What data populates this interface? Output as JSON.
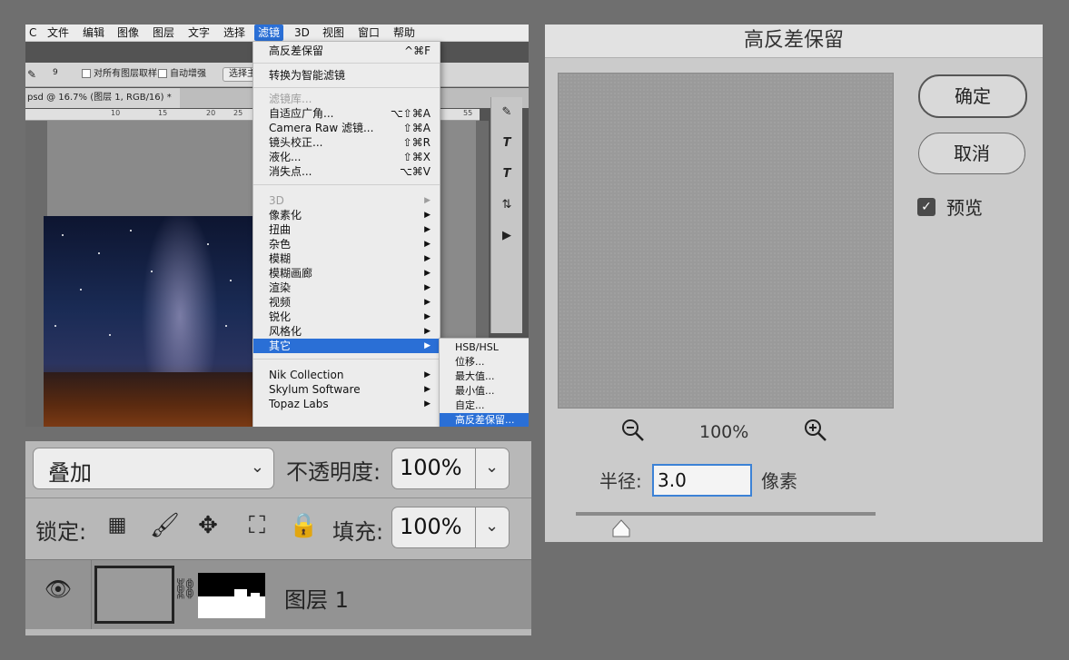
{
  "menubar": {
    "items": [
      "C",
      "文件",
      "编辑",
      "图像",
      "图层",
      "文字",
      "选择",
      "滤镜",
      "3D",
      "视图",
      "窗口",
      "帮助"
    ],
    "active": "滤镜"
  },
  "options_bar": {
    "brush_size": "9",
    "sample_all_layers": "对所有图层取样",
    "auto_enhance": "自动增强",
    "select_subject": "选择主"
  },
  "document_tab": "psd @ 16.7% (图层 1, RGB/16) *",
  "ruler_ticks": [
    "10",
    "15",
    "20",
    "25",
    "55"
  ],
  "filter_menu": {
    "items": [
      {
        "label": "高反差保留",
        "shortcut": "^⌘F"
      },
      {
        "label": "转换为智能滤镜"
      },
      {
        "label": "滤镜库...",
        "disabled": true
      },
      {
        "label": "自适应广角...",
        "shortcut": "⌥⇧⌘A"
      },
      {
        "label": "Camera Raw 滤镜...",
        "shortcut": "⇧⌘A"
      },
      {
        "label": "镜头校正...",
        "shortcut": "⇧⌘R"
      },
      {
        "label": "液化...",
        "shortcut": "⇧⌘X"
      },
      {
        "label": "消失点...",
        "shortcut": "⌥⌘V"
      },
      {
        "label": "3D",
        "disabled": true,
        "submenu": true
      },
      {
        "label": "像素化",
        "submenu": true
      },
      {
        "label": "扭曲",
        "submenu": true
      },
      {
        "label": "杂色",
        "submenu": true
      },
      {
        "label": "模糊",
        "submenu": true
      },
      {
        "label": "模糊画廊",
        "submenu": true
      },
      {
        "label": "渲染",
        "submenu": true
      },
      {
        "label": "视频",
        "submenu": true
      },
      {
        "label": "锐化",
        "submenu": true
      },
      {
        "label": "风格化",
        "submenu": true
      },
      {
        "label": "其它",
        "submenu": true,
        "highlighted": true
      },
      {
        "label": "Nik Collection",
        "submenu": true
      },
      {
        "label": "Skylum Software",
        "submenu": true
      },
      {
        "label": "Topaz Labs",
        "submenu": true
      }
    ]
  },
  "other_submenu": {
    "items": [
      {
        "label": "HSB/HSL"
      },
      {
        "label": "位移..."
      },
      {
        "label": "最大值..."
      },
      {
        "label": "最小值..."
      },
      {
        "label": "自定..."
      },
      {
        "label": "高反差保留...",
        "highlighted": true
      }
    ]
  },
  "layers_panel": {
    "blend_mode": "叠加",
    "opacity_label": "不透明度:",
    "opacity_value": "100%",
    "lock_label": "锁定:",
    "fill_label": "填充:",
    "fill_value": "100%",
    "layer_name": "图层 1"
  },
  "dialog": {
    "title": "高反差保留",
    "ok_label": "确定",
    "cancel_label": "取消",
    "preview_label": "预览",
    "preview_checked": true,
    "zoom_value": "100%",
    "radius_label": "半径:",
    "radius_value": "3.0",
    "radius_unit": "像素",
    "slider_fraction": 0.15
  },
  "colors": {
    "accent": "#2a6fd6",
    "input_focus": "#3c82d6"
  }
}
